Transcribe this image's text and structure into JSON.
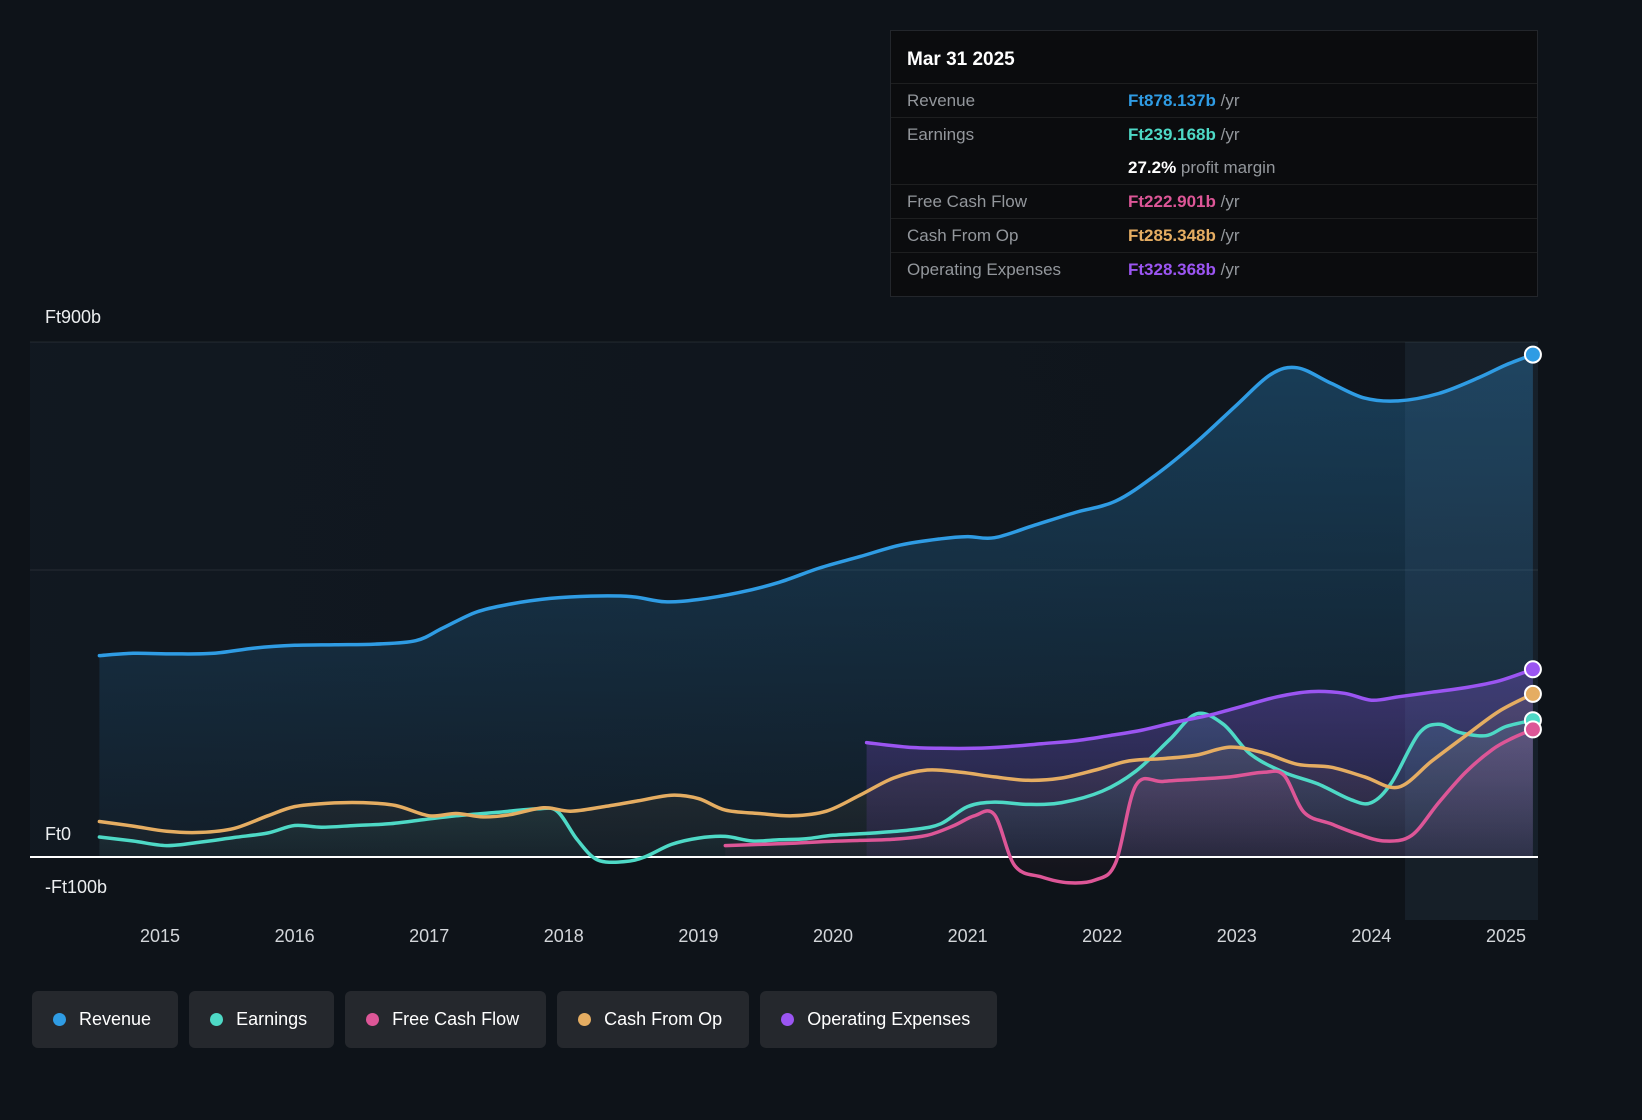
{
  "tooltip": {
    "date": "Mar 31 2025",
    "rows": [
      {
        "key": "revenue",
        "label": "Revenue",
        "value": "Ft878.137b",
        "suffix": " /yr"
      },
      {
        "key": "earnings",
        "label": "Earnings",
        "value": "Ft239.168b",
        "suffix": " /yr"
      },
      {
        "key": "fcf",
        "label": "Free Cash Flow",
        "value": "Ft222.901b",
        "suffix": " /yr"
      },
      {
        "key": "cashop",
        "label": "Cash From Op",
        "value": "Ft285.348b",
        "suffix": " /yr"
      },
      {
        "key": "opex",
        "label": "Operating Expenses",
        "value": "Ft328.368b",
        "suffix": " /yr"
      }
    ],
    "margin": {
      "value": "27.2%",
      "label": " profit margin"
    }
  },
  "legend": [
    {
      "key": "revenue",
      "label": "Revenue"
    },
    {
      "key": "earnings",
      "label": "Earnings"
    },
    {
      "key": "fcf",
      "label": "Free Cash Flow"
    },
    {
      "key": "cashop",
      "label": "Cash From Op"
    },
    {
      "key": "opex",
      "label": "Operating Expenses"
    }
  ],
  "chart_data": {
    "type": "line",
    "title": "",
    "x_unit": "year",
    "y_unit": "Ft billions /yr",
    "ylim": [
      -100,
      900
    ],
    "y_tick_labels": [
      "Ft900b",
      "Ft0",
      "-Ft100b"
    ],
    "x_ticks": [
      2015,
      2016,
      2017,
      2018,
      2019,
      2020,
      2021,
      2022,
      2023,
      2024,
      2025
    ],
    "grid": "horizontal",
    "legend_position": "bottom",
    "highlight_band_start": 2024.25,
    "series": [
      {
        "name": "Revenue",
        "key": "revenue",
        "color": "#2f9ce4",
        "points": [
          [
            2014.55,
            352
          ],
          [
            2014.8,
            356
          ],
          [
            2015.1,
            355
          ],
          [
            2015.4,
            356
          ],
          [
            2015.7,
            365
          ],
          [
            2016.0,
            370
          ],
          [
            2016.3,
            371
          ],
          [
            2016.6,
            372
          ],
          [
            2016.9,
            378
          ],
          [
            2017.1,
            400
          ],
          [
            2017.35,
            428
          ],
          [
            2017.6,
            442
          ],
          [
            2017.9,
            452
          ],
          [
            2018.2,
            456
          ],
          [
            2018.5,
            455
          ],
          [
            2018.75,
            446
          ],
          [
            2019.0,
            450
          ],
          [
            2019.3,
            462
          ],
          [
            2019.6,
            480
          ],
          [
            2019.9,
            505
          ],
          [
            2020.2,
            525
          ],
          [
            2020.5,
            545
          ],
          [
            2020.8,
            556
          ],
          [
            2021.0,
            560
          ],
          [
            2021.2,
            558
          ],
          [
            2021.5,
            580
          ],
          [
            2021.8,
            602
          ],
          [
            2022.1,
            622
          ],
          [
            2022.4,
            668
          ],
          [
            2022.7,
            725
          ],
          [
            2023.0,
            790
          ],
          [
            2023.25,
            843
          ],
          [
            2023.45,
            855
          ],
          [
            2023.7,
            828
          ],
          [
            2023.95,
            802
          ],
          [
            2024.2,
            797
          ],
          [
            2024.5,
            810
          ],
          [
            2024.8,
            838
          ],
          [
            2025.0,
            860
          ],
          [
            2025.2,
            878
          ]
        ]
      },
      {
        "name": "Earnings",
        "key": "earnings",
        "color": "#4ed9c6",
        "points": [
          [
            2014.55,
            35
          ],
          [
            2014.8,
            28
          ],
          [
            2015.05,
            20
          ],
          [
            2015.3,
            26
          ],
          [
            2015.55,
            34
          ],
          [
            2015.8,
            42
          ],
          [
            2016.0,
            55
          ],
          [
            2016.2,
            52
          ],
          [
            2016.45,
            55
          ],
          [
            2016.7,
            58
          ],
          [
            2016.95,
            65
          ],
          [
            2017.2,
            72
          ],
          [
            2017.5,
            78
          ],
          [
            2017.8,
            84
          ],
          [
            2017.95,
            80
          ],
          [
            2018.1,
            30
          ],
          [
            2018.25,
            -5
          ],
          [
            2018.45,
            -8
          ],
          [
            2018.6,
            0
          ],
          [
            2018.8,
            22
          ],
          [
            2019.0,
            33
          ],
          [
            2019.2,
            36
          ],
          [
            2019.4,
            28
          ],
          [
            2019.6,
            30
          ],
          [
            2019.8,
            32
          ],
          [
            2020.0,
            38
          ],
          [
            2020.3,
            42
          ],
          [
            2020.6,
            48
          ],
          [
            2020.8,
            58
          ],
          [
            2021.0,
            88
          ],
          [
            2021.2,
            96
          ],
          [
            2021.45,
            92
          ],
          [
            2021.7,
            95
          ],
          [
            2022.0,
            115
          ],
          [
            2022.25,
            150
          ],
          [
            2022.5,
            205
          ],
          [
            2022.7,
            250
          ],
          [
            2022.9,
            232
          ],
          [
            2023.1,
            180
          ],
          [
            2023.35,
            148
          ],
          [
            2023.6,
            128
          ],
          [
            2023.85,
            100
          ],
          [
            2024.0,
            95
          ],
          [
            2024.15,
            130
          ],
          [
            2024.35,
            215
          ],
          [
            2024.5,
            232
          ],
          [
            2024.65,
            218
          ],
          [
            2024.85,
            212
          ],
          [
            2025.0,
            228
          ],
          [
            2025.2,
            239
          ]
        ]
      },
      {
        "name": "Free Cash Flow",
        "key": "fcf",
        "color": "#dd5697",
        "points": [
          [
            2019.2,
            20
          ],
          [
            2019.45,
            22
          ],
          [
            2019.7,
            24
          ],
          [
            2019.95,
            27
          ],
          [
            2020.2,
            29
          ],
          [
            2020.45,
            31
          ],
          [
            2020.7,
            38
          ],
          [
            2020.9,
            55
          ],
          [
            2021.05,
            72
          ],
          [
            2021.2,
            74
          ],
          [
            2021.35,
            -15
          ],
          [
            2021.55,
            -35
          ],
          [
            2021.75,
            -45
          ],
          [
            2021.95,
            -40
          ],
          [
            2022.1,
            -10
          ],
          [
            2022.25,
            125
          ],
          [
            2022.45,
            132
          ],
          [
            2022.7,
            136
          ],
          [
            2022.95,
            140
          ],
          [
            2023.2,
            148
          ],
          [
            2023.35,
            143
          ],
          [
            2023.5,
            78
          ],
          [
            2023.7,
            58
          ],
          [
            2023.9,
            40
          ],
          [
            2024.1,
            28
          ],
          [
            2024.3,
            38
          ],
          [
            2024.5,
            95
          ],
          [
            2024.7,
            148
          ],
          [
            2024.9,
            188
          ],
          [
            2025.05,
            208
          ],
          [
            2025.2,
            223
          ]
        ]
      },
      {
        "name": "Cash From Op",
        "key": "cashop",
        "color": "#e5ad62",
        "points": [
          [
            2014.55,
            62
          ],
          [
            2014.8,
            54
          ],
          [
            2015.05,
            45
          ],
          [
            2015.3,
            43
          ],
          [
            2015.55,
            50
          ],
          [
            2015.8,
            72
          ],
          [
            2016.0,
            88
          ],
          [
            2016.25,
            94
          ],
          [
            2016.5,
            95
          ],
          [
            2016.75,
            90
          ],
          [
            2017.0,
            72
          ],
          [
            2017.2,
            76
          ],
          [
            2017.4,
            70
          ],
          [
            2017.6,
            74
          ],
          [
            2017.85,
            86
          ],
          [
            2018.05,
            80
          ],
          [
            2018.3,
            88
          ],
          [
            2018.55,
            98
          ],
          [
            2018.8,
            108
          ],
          [
            2019.0,
            102
          ],
          [
            2019.2,
            82
          ],
          [
            2019.45,
            76
          ],
          [
            2019.7,
            72
          ],
          [
            2019.95,
            80
          ],
          [
            2020.2,
            108
          ],
          [
            2020.45,
            138
          ],
          [
            2020.7,
            152
          ],
          [
            2020.95,
            148
          ],
          [
            2021.2,
            140
          ],
          [
            2021.45,
            134
          ],
          [
            2021.7,
            138
          ],
          [
            2021.95,
            152
          ],
          [
            2022.2,
            168
          ],
          [
            2022.45,
            172
          ],
          [
            2022.7,
            178
          ],
          [
            2022.95,
            192
          ],
          [
            2023.2,
            182
          ],
          [
            2023.45,
            162
          ],
          [
            2023.7,
            157
          ],
          [
            2023.95,
            140
          ],
          [
            2024.2,
            122
          ],
          [
            2024.45,
            168
          ],
          [
            2024.7,
            212
          ],
          [
            2024.95,
            255
          ],
          [
            2025.2,
            285
          ]
        ]
      },
      {
        "name": "Operating Expenses",
        "key": "opex",
        "color": "#9b55f2",
        "points": [
          [
            2020.25,
            200
          ],
          [
            2020.55,
            192
          ],
          [
            2020.8,
            190
          ],
          [
            2021.05,
            190
          ],
          [
            2021.3,
            193
          ],
          [
            2021.55,
            198
          ],
          [
            2021.8,
            203
          ],
          [
            2022.05,
            212
          ],
          [
            2022.3,
            222
          ],
          [
            2022.55,
            236
          ],
          [
            2022.8,
            248
          ],
          [
            2023.05,
            264
          ],
          [
            2023.3,
            280
          ],
          [
            2023.55,
            289
          ],
          [
            2023.8,
            286
          ],
          [
            2024.0,
            274
          ],
          [
            2024.2,
            280
          ],
          [
            2024.45,
            288
          ],
          [
            2024.7,
            296
          ],
          [
            2024.95,
            308
          ],
          [
            2025.2,
            328
          ]
        ]
      }
    ]
  }
}
